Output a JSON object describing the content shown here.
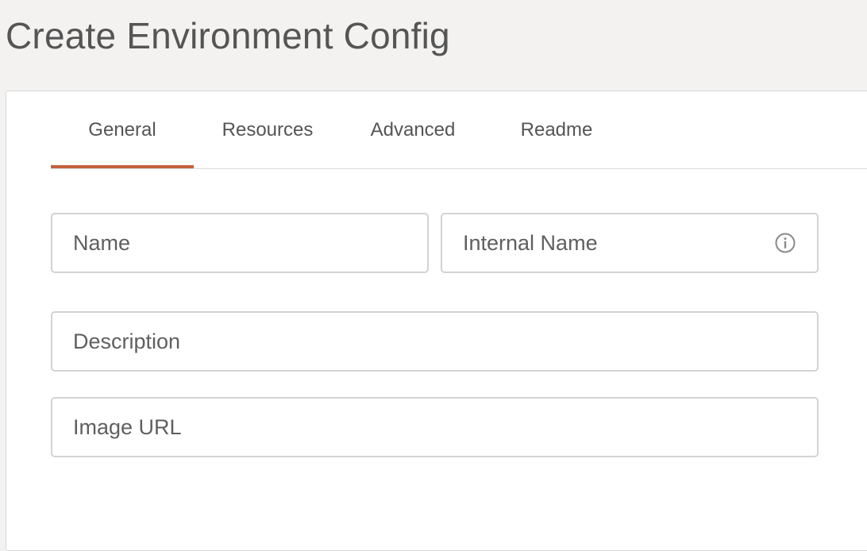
{
  "page": {
    "title": "Create Environment Config"
  },
  "tabs": [
    {
      "label": "General",
      "active": true
    },
    {
      "label": "Resources",
      "active": false
    },
    {
      "label": "Advanced",
      "active": false
    },
    {
      "label": "Readme",
      "active": false
    }
  ],
  "form": {
    "name": {
      "placeholder": "Name",
      "value": ""
    },
    "internal_name": {
      "placeholder": "Internal Name",
      "value": "",
      "icon": "info-icon"
    },
    "description": {
      "placeholder": "Description",
      "value": ""
    },
    "image_url": {
      "placeholder": "Image URL",
      "value": ""
    }
  },
  "colors": {
    "accent": "#c4623e",
    "page_background": "#f3f2f1",
    "card_background": "#ffffff",
    "text": "#555555",
    "border": "#d3d3d3"
  }
}
